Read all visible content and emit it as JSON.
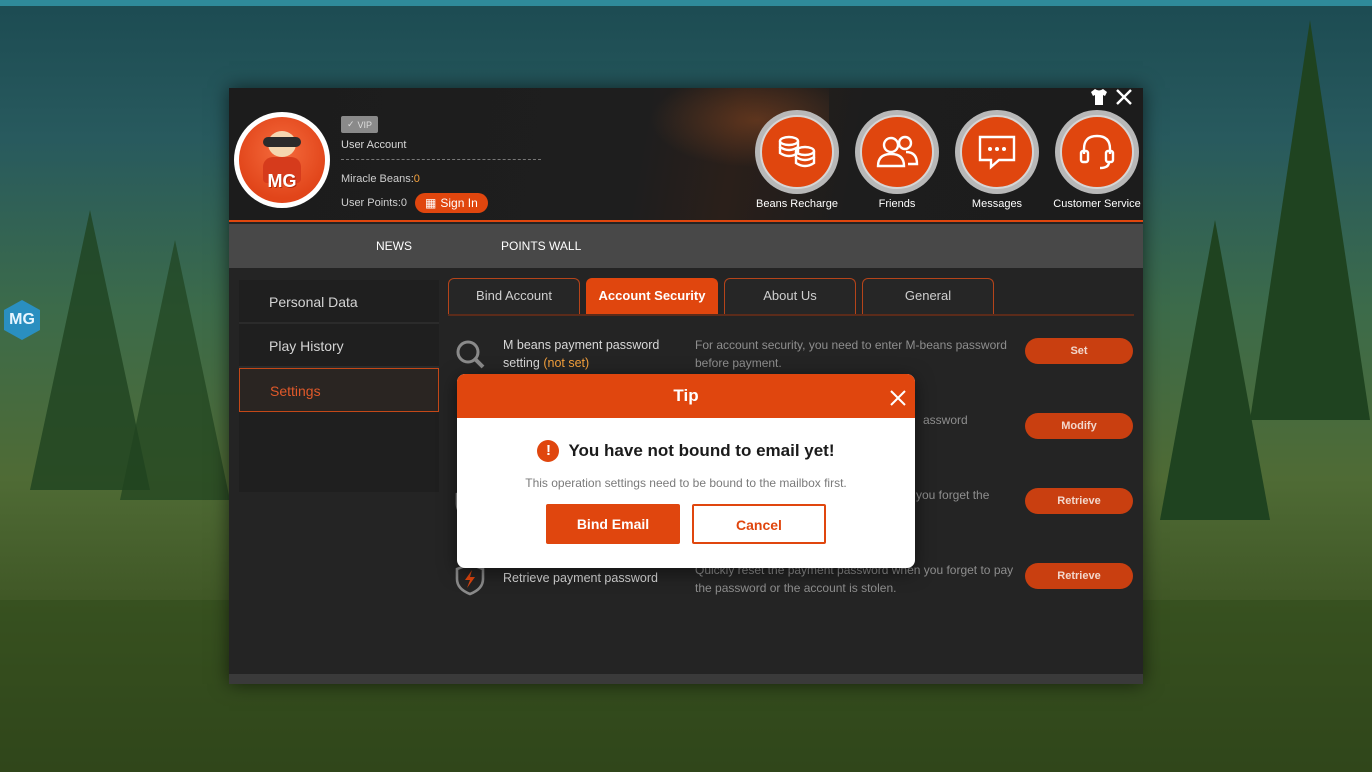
{
  "header": {
    "vip_label": "VIP",
    "user_account": "User Account",
    "miracle_beans_label": "Miracle Beans:",
    "miracle_beans_value": "0",
    "user_points_label": "User Points:",
    "user_points_value": "0",
    "sign_in": "Sign In",
    "avatar_text": "MG",
    "shortcuts": [
      {
        "label": "Beans Recharge",
        "icon": "coins-icon"
      },
      {
        "label": "Friends",
        "icon": "friends-icon"
      },
      {
        "label": "Messages",
        "icon": "message-icon"
      },
      {
        "label": "Customer Service",
        "icon": "headset-icon"
      }
    ]
  },
  "nav": {
    "items": [
      "NEWS",
      "POINTS WALL"
    ]
  },
  "sidebar": {
    "items": [
      "Personal Data",
      "Play History",
      "Settings"
    ],
    "active": "Settings"
  },
  "tabs": {
    "items": [
      "Bind Account",
      "Account Security",
      "About Us",
      "General"
    ],
    "active": "Account Security"
  },
  "security_rows": [
    {
      "title": "M beans payment password setting",
      "status": "(not set)",
      "desc": "For account security, you need to enter M-beans password before payment.",
      "button": "Set"
    },
    {
      "title": "",
      "status": "",
      "desc": "assword",
      "button": "Modify"
    },
    {
      "title": "",
      "status": "",
      "desc": "you forget the",
      "button": "Retrieve"
    },
    {
      "title": "Retrieve payment password",
      "status": "",
      "desc": "Quickly reset the payment password when you forget to pay the password or the account is stolen.",
      "button": "Retrieve"
    }
  ],
  "dialog": {
    "title": "Tip",
    "message": "You have not bound to email yet!",
    "sub": "This operation settings need to be bound to the mailbox first.",
    "primary": "Bind Email",
    "secondary": "Cancel"
  },
  "background": {
    "badge": "MG"
  },
  "colors": {
    "accent": "#e0460e",
    "window_bg": "#242424"
  }
}
